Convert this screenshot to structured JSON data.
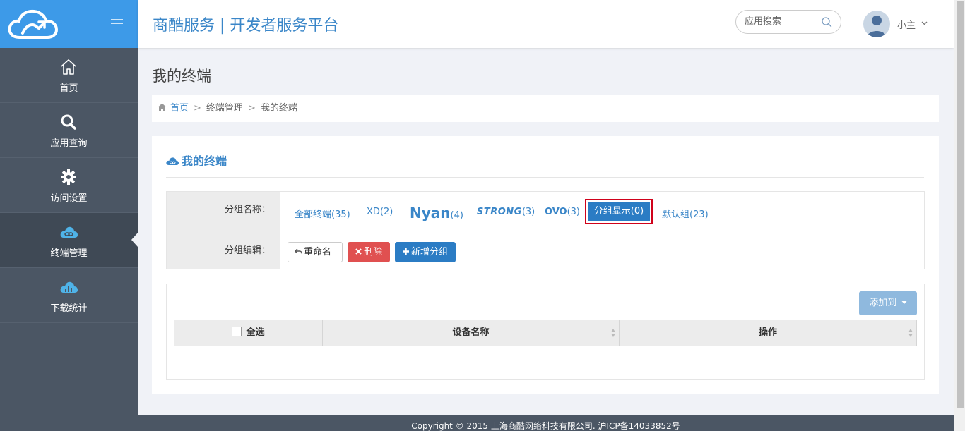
{
  "header": {
    "title": "商酷服务 | 开发者服务平台",
    "search_placeholder": "应用搜索",
    "user_name": "小主"
  },
  "sidebar": {
    "items": [
      {
        "label": "首页",
        "icon": "home-icon"
      },
      {
        "label": "应用查询",
        "icon": "search-icon"
      },
      {
        "label": "访问设置",
        "icon": "gear-icon"
      },
      {
        "label": "终端管理",
        "icon": "cloud-link-icon",
        "active": true
      },
      {
        "label": "下载统计",
        "icon": "cloud-chart-icon"
      }
    ]
  },
  "page": {
    "title": "我的终端",
    "breadcrumb": [
      "首页",
      "终端管理",
      "我的终端"
    ]
  },
  "panel": {
    "title": "我的终端",
    "group_name_label": "分组名称：",
    "group_edit_label": "分组编辑：",
    "groups": [
      {
        "name": "全部终端",
        "count": "(35)"
      },
      {
        "name": "XD",
        "count": "(2)"
      },
      {
        "name": "Nyan",
        "count": "(4)"
      },
      {
        "name": "STRONG",
        "count": "(3)"
      },
      {
        "name": "OVO",
        "count": "(3)"
      },
      {
        "name": "分组显示",
        "count": "(0)",
        "selected": true
      },
      {
        "name": "默认组",
        "count": "(23)"
      }
    ],
    "buttons": {
      "rename": "重命名",
      "delete": "删除",
      "add_group": "新增分组",
      "add_to": "添加到"
    },
    "table": {
      "headers": [
        "全选",
        "设备名称",
        "操作"
      ]
    }
  },
  "footer": {
    "copyright": "Copyright © 2015 上海商酷网络科技有限公司. 沪ICP备14033852号"
  },
  "colors": {
    "brand_blue": "#3d9ae8",
    "link_blue": "#3a86c8",
    "sidebar_bg": "#4b5664",
    "danger": "#e05050",
    "highlight_border": "#d0021b"
  }
}
